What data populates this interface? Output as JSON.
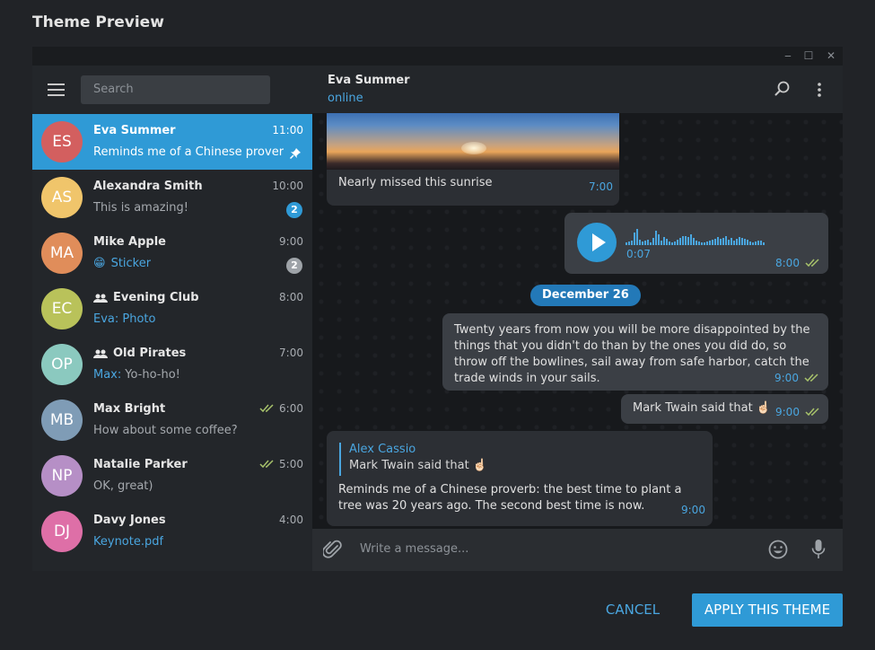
{
  "dialog": {
    "title": "Theme Preview"
  },
  "window_controls": {
    "minimize": "‒",
    "maximize": "☐",
    "close": "✕"
  },
  "search": {
    "placeholder": "Search"
  },
  "chats": [
    {
      "initials": "ES",
      "name": "Eva Summer",
      "time": "11:00",
      "preview": "Reminds me of a Chinese proverb: the best time to plant a tree",
      "avatar_color": "#d35f5f",
      "pinned": true,
      "active": true
    },
    {
      "initials": "AS",
      "name": "Alexandra Smith",
      "time": "10:00",
      "preview": "This is amazing!",
      "avatar_color": "#f0c56b",
      "badge": "2",
      "badge_color": "#2f9ad6"
    },
    {
      "initials": "MA",
      "name": "Mike Apple",
      "time": "9:00",
      "preview_icon": "😁",
      "preview": "Sticker",
      "preview_blue": true,
      "avatar_color": "#e08d5a",
      "badge": "2",
      "badge_color": "#9ea3a8"
    },
    {
      "initials": "EC",
      "name": "Evening Club",
      "group": true,
      "time": "8:00",
      "preview": "Eva: Photo",
      "preview_blue": true,
      "avatar_color": "#b9c25a"
    },
    {
      "initials": "OP",
      "name": "Old Pirates",
      "group": true,
      "time": "7:00",
      "preview_sender": "Max:",
      "preview": "Yo-ho-ho!",
      "avatar_color": "#8bc9bf"
    },
    {
      "initials": "MB",
      "name": "Max Bright",
      "time": "6:00",
      "read": true,
      "preview": "How about some coffee?",
      "avatar_color": "#7f9cb6"
    },
    {
      "initials": "NP",
      "name": "Natalie Parker",
      "time": "5:00",
      "read": true,
      "preview": "OK, great)",
      "avatar_color": "#b68fc6"
    },
    {
      "initials": "DJ",
      "name": "Davy Jones",
      "time": "4:00",
      "preview": "Keynote.pdf",
      "preview_blue": true,
      "avatar_color": "#de6fa7"
    }
  ],
  "peer": {
    "name": "Eva Summer",
    "status": "online"
  },
  "messages": {
    "photo_caption": "Nearly missed this sunrise",
    "photo_time": "7:00",
    "voice_duration": "0:07",
    "voice_time": "8:00",
    "date_separator": "December 26",
    "quote_text": "Twenty years from now you will be more disappointed by the things that you didn't do than by the ones you did do, so throw off the bowlines, sail away from safe harbor, catch the trade winds in your sails.",
    "quote_time": "9:00",
    "twain_text": "Mark Twain said that",
    "twain_emoji": "☝🏻",
    "twain_time": "9:00",
    "reply_author": "Alex Cassio",
    "reply_quoted": "Mark Twain said that",
    "reply_emoji": "☝🏻",
    "reply_text": "Reminds me of a Chinese proverb: the best time to plant a tree was 20 years ago. The second best time is now.",
    "reply_time": "9:00"
  },
  "voice_wave": [
    3,
    4,
    5,
    14,
    18,
    6,
    4,
    5,
    6,
    3,
    8,
    16,
    12,
    5,
    9,
    7,
    4,
    3,
    4,
    6,
    8,
    10,
    10,
    9,
    12,
    8,
    5,
    4,
    3,
    3,
    4,
    5,
    6,
    7,
    9,
    7,
    8,
    10,
    6,
    8,
    5,
    7,
    9,
    8,
    7,
    6,
    4,
    3,
    4,
    5,
    5,
    3
  ],
  "composer": {
    "placeholder": "Write a message..."
  },
  "actions": {
    "cancel": "CANCEL",
    "apply": "APPLY THIS THEME"
  },
  "colors": {
    "accent": "#2f9ad6",
    "link": "#4aa6e0",
    "read_ticks": "#a7c26b"
  }
}
